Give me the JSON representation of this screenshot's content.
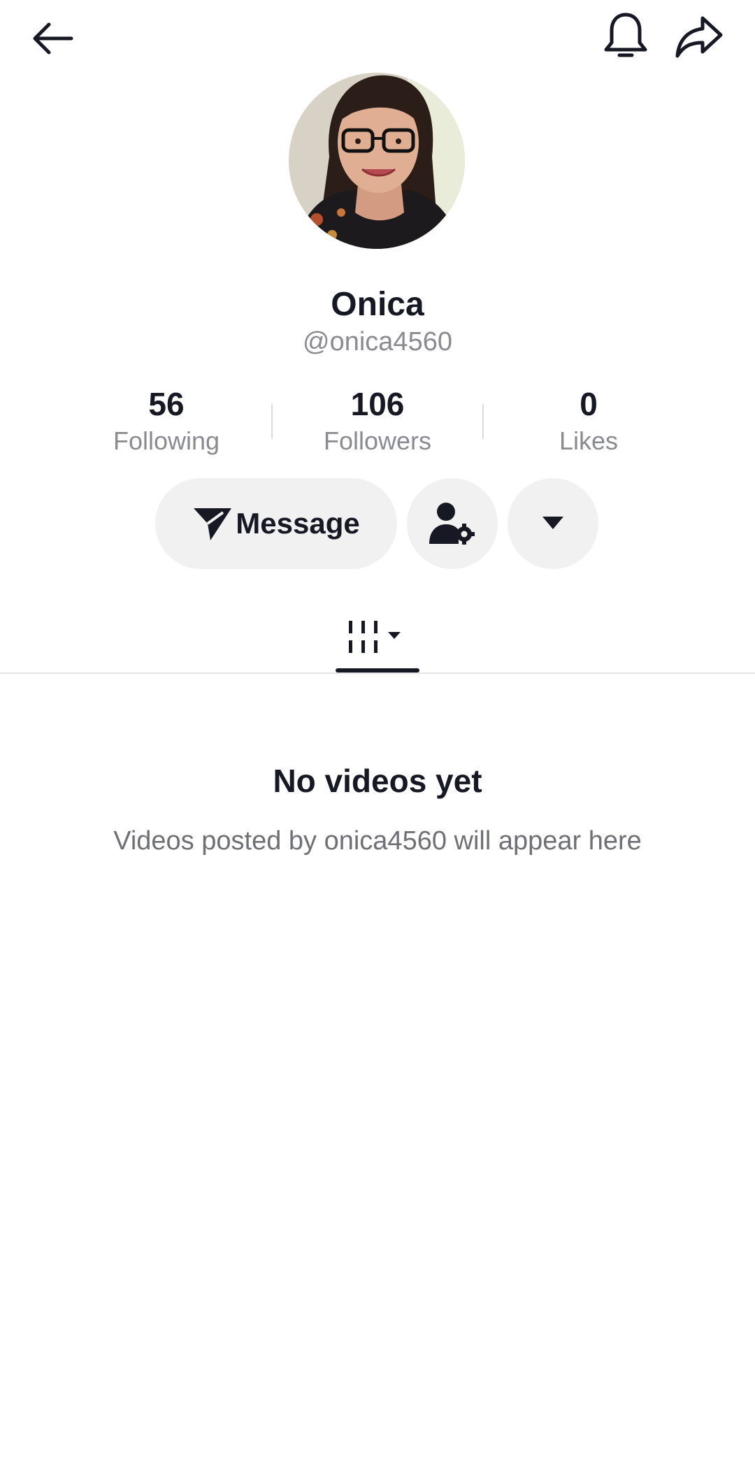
{
  "header": {
    "back_icon": "arrow-left-icon",
    "notification_icon": "bell-icon",
    "share_icon": "share-arrow-icon"
  },
  "profile": {
    "avatar_icon": "profile-photo",
    "display_name": "Onica",
    "username": "@onica4560"
  },
  "stats": [
    {
      "value": "56",
      "label": "Following"
    },
    {
      "value": "106",
      "label": "Followers"
    },
    {
      "value": "0",
      "label": "Likes"
    }
  ],
  "actions": {
    "message_label": "Message",
    "message_icon": "send-icon",
    "friend_settings_icon": "person-gear-icon",
    "more_icon": "caret-down-icon",
    "button_background": "#f1f1f2"
  },
  "tabs": {
    "active_icon": "video-grid-icon"
  },
  "empty_state": {
    "title": "No videos yet",
    "message": "Videos posted by onica4560 will appear here"
  },
  "colors": {
    "text_primary": "#161823",
    "text_secondary": "#8a8b91"
  }
}
